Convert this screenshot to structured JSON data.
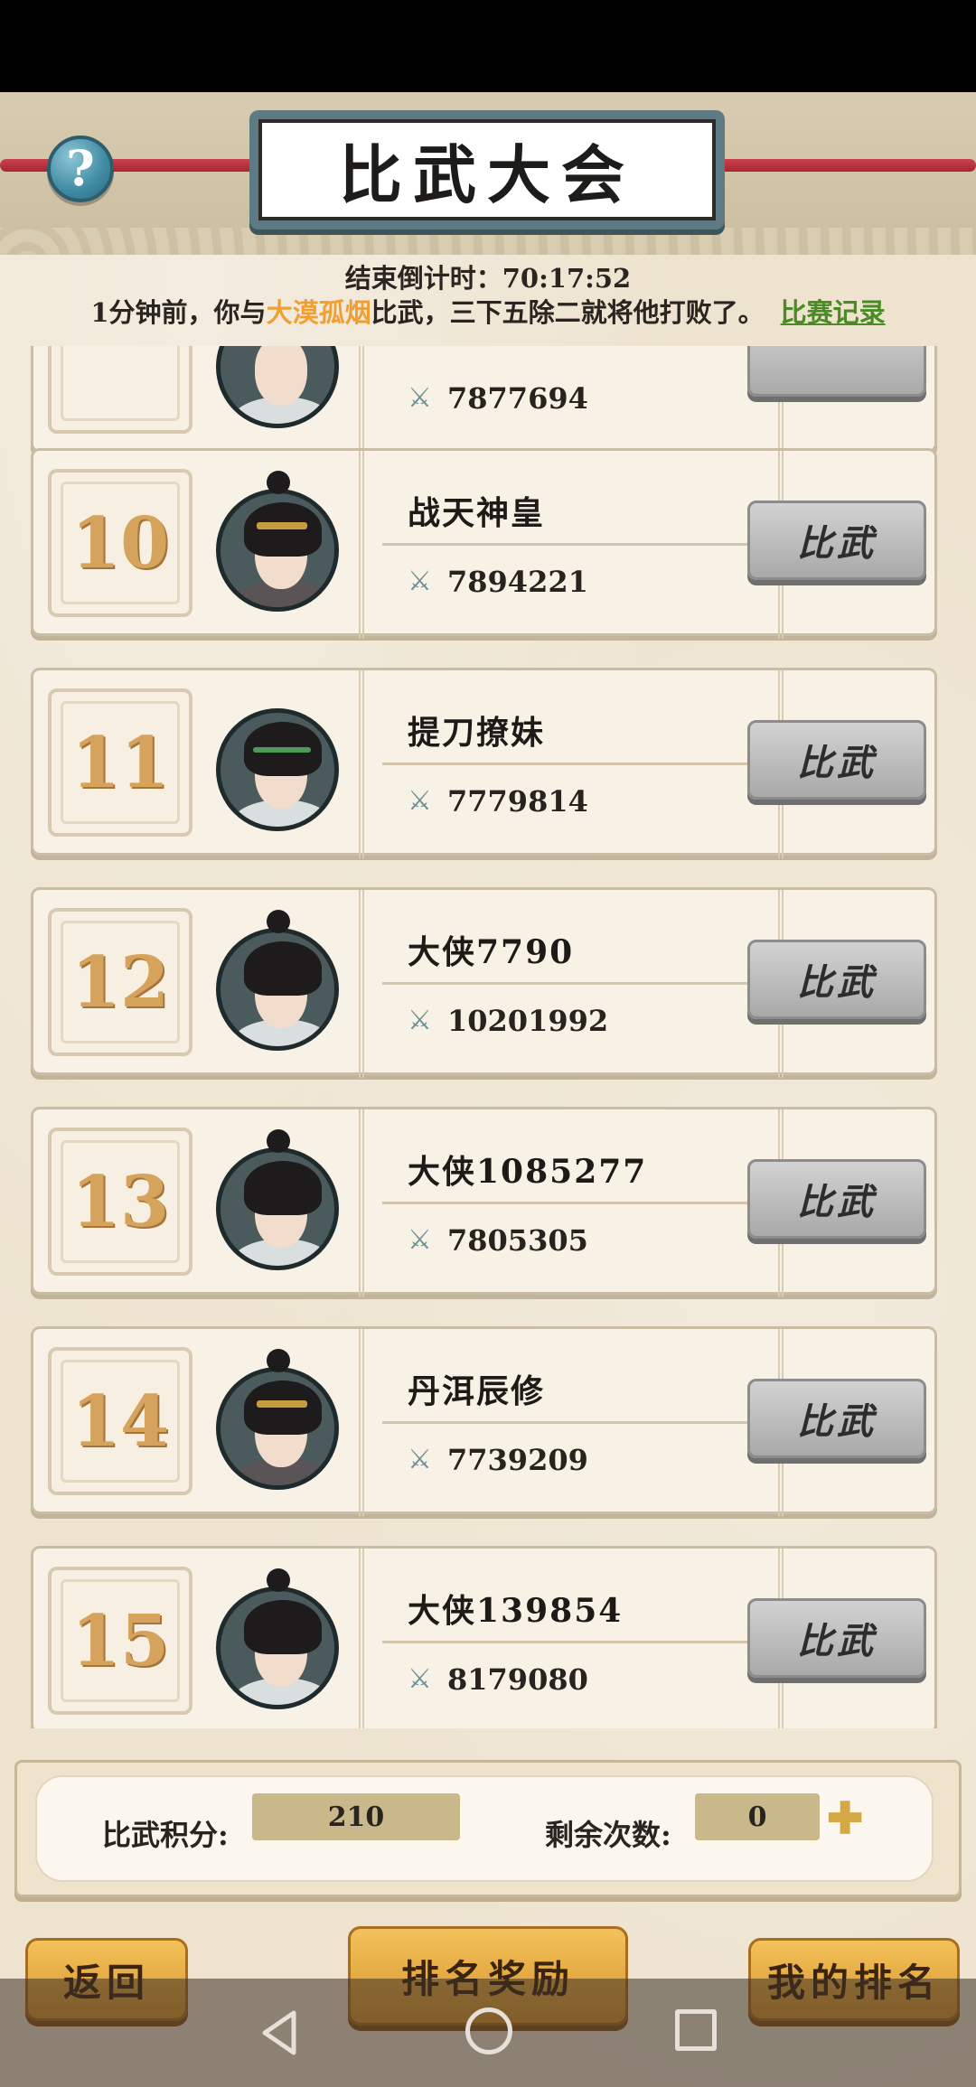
{
  "header": {
    "title": "比武大会",
    "help_label": "?",
    "countdown_label": "结束倒计时：70:17:52",
    "message": {
      "prefix": "1分钟前，你与",
      "opponent": "大漠孤烟",
      "suffix": "比武，三下五除二就将他打败了。",
      "record_link": "比赛记录"
    }
  },
  "list": {
    "partial_row": {
      "power": "7877694"
    },
    "rows": [
      {
        "rank": "10",
        "name": "战天神皇",
        "power": "7894221",
        "avatar": "warrior-gold-crown",
        "button": "比武"
      },
      {
        "rank": "11",
        "name": "提刀撩妹",
        "power": "7779814",
        "avatar": "swordsman-green-band",
        "button": "比武"
      },
      {
        "rank": "12",
        "name": "大侠7790",
        "power": "10201992",
        "avatar": "scholar-white-robe",
        "button": "比武"
      },
      {
        "rank": "13",
        "name": "大侠1085277",
        "power": "7805305",
        "avatar": "scholar-white-robe",
        "button": "比武"
      },
      {
        "rank": "14",
        "name": "丹洱辰修",
        "power": "7739209",
        "avatar": "warrior-gold-crown",
        "button": "比武"
      },
      {
        "rank": "15",
        "name": "大侠139854",
        "power": "8179080",
        "avatar": "scholar-white-robe",
        "button": "比武"
      }
    ]
  },
  "stats": {
    "score_label": "比武积分:",
    "score_value": "210",
    "remaining_label": "剩余次数:",
    "remaining_value": "0",
    "add_icon": "plus-icon"
  },
  "buttons": {
    "back": "返回",
    "rank_reward": "排名奖励",
    "my_rank": "我的排名"
  },
  "colors": {
    "opponent_highlight": "#f0a033",
    "record_link": "#4c8a25",
    "rank_number": "#d6a35c"
  }
}
